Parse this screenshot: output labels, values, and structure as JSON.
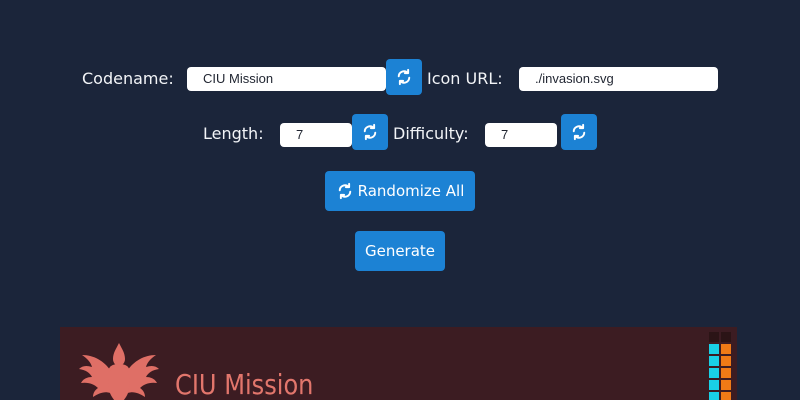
{
  "form": {
    "codename_label": "Codename:",
    "codename_value": "CIU Mission",
    "icon_url_label": "Icon URL:",
    "icon_url_value": "./invasion.svg",
    "length_label": "Length:",
    "length_value": "7",
    "difficulty_label": "Difficulty:",
    "difficulty_value": "7",
    "randomize_icon": "refresh-icon"
  },
  "actions": {
    "randomize_all_label": "Randomize All",
    "generate_label": "Generate"
  },
  "preview": {
    "title": "CIU Mission",
    "emblem_icon": "phoenix-emblem-icon",
    "meter": {
      "left_column": [
        "#2b1416",
        "#19d0e6",
        "#19d0e6",
        "#19d0e6",
        "#19d0e6",
        "#19d0e6"
      ],
      "right_column": [
        "#2b1416",
        "#f07a16",
        "#f07a16",
        "#f07a16",
        "#f07a16",
        "#f07a16"
      ]
    }
  },
  "colors": {
    "background": "#1b253a",
    "accent": "#1c82d4",
    "preview_background": "#3c1c22",
    "preview_title": "#e2766c"
  }
}
